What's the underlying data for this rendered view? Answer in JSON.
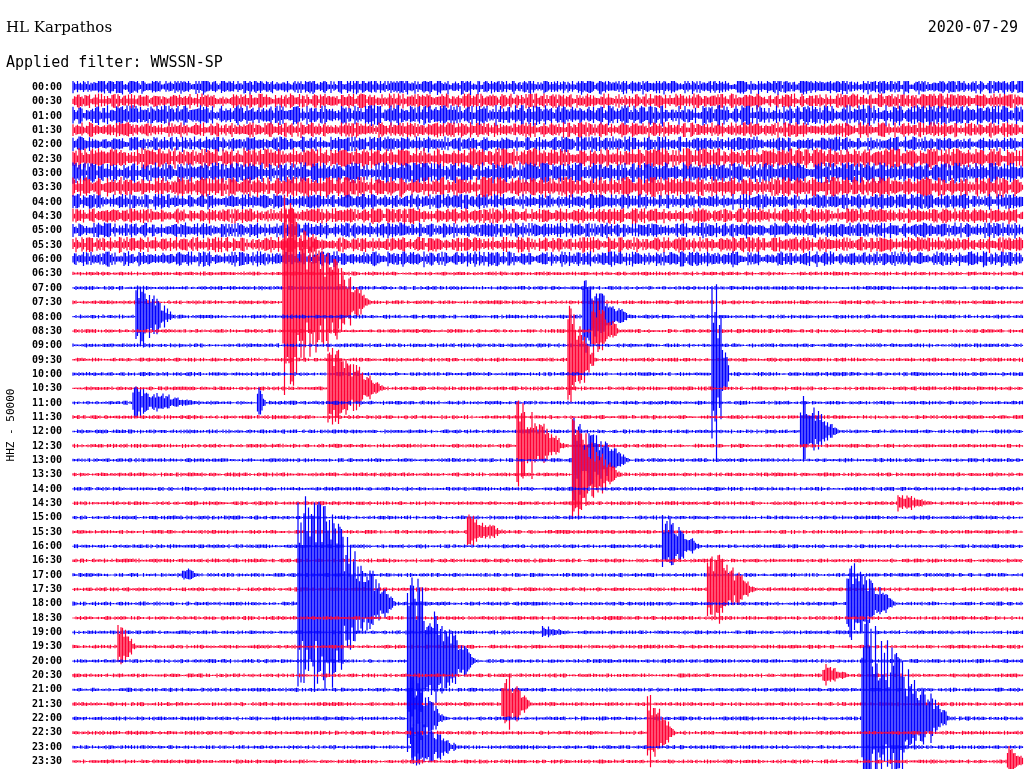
{
  "station": "HL Karpathos",
  "date": "2020-07-29",
  "filter": "Applied filter: WWSSN-SP",
  "channel_label": "HHZ - 50000",
  "traces": [
    {
      "time": "00:00",
      "color": "#0000ff"
    },
    {
      "time": "00:30",
      "color": "#ff0033"
    },
    {
      "time": "01:00",
      "color": "#0000ff"
    },
    {
      "time": "01:30",
      "color": "#ff0033"
    },
    {
      "time": "02:00",
      "color": "#0000ff"
    },
    {
      "time": "02:30",
      "color": "#ff0033"
    },
    {
      "time": "03:00",
      "color": "#0000ff"
    },
    {
      "time": "03:30",
      "color": "#ff0033"
    },
    {
      "time": "04:00",
      "color": "#0000ff"
    },
    {
      "time": "04:30",
      "color": "#ff0033"
    },
    {
      "time": "05:00",
      "color": "#0000ff"
    },
    {
      "time": "05:30",
      "color": "#ff0033"
    },
    {
      "time": "06:00",
      "color": "#0000ff"
    },
    {
      "time": "06:30",
      "color": "#ff0033"
    },
    {
      "time": "07:00",
      "color": "#0000ff"
    },
    {
      "time": "07:30",
      "color": "#ff0033"
    },
    {
      "time": "08:00",
      "color": "#0000ff"
    },
    {
      "time": "08:30",
      "color": "#ff0033"
    },
    {
      "time": "09:00",
      "color": "#0000ff"
    },
    {
      "time": "09:30",
      "color": "#ff0033"
    },
    {
      "time": "10:00",
      "color": "#0000ff"
    },
    {
      "time": "10:30",
      "color": "#ff0033"
    },
    {
      "time": "11:00",
      "color": "#0000ff"
    },
    {
      "time": "11:30",
      "color": "#ff0033"
    },
    {
      "time": "12:00",
      "color": "#0000ff"
    },
    {
      "time": "12:30",
      "color": "#ff0033"
    },
    {
      "time": "13:00",
      "color": "#0000ff"
    },
    {
      "time": "13:30",
      "color": "#ff0033"
    },
    {
      "time": "14:00",
      "color": "#0000ff"
    },
    {
      "time": "14:30",
      "color": "#ff0033"
    },
    {
      "time": "15:00",
      "color": "#0000ff"
    },
    {
      "time": "15:30",
      "color": "#ff0033"
    },
    {
      "time": "16:00",
      "color": "#0000ff"
    },
    {
      "time": "16:30",
      "color": "#ff0033"
    },
    {
      "time": "17:00",
      "color": "#0000ff"
    },
    {
      "time": "17:30",
      "color": "#ff0033"
    },
    {
      "time": "18:00",
      "color": "#0000ff"
    },
    {
      "time": "18:30",
      "color": "#ff0033"
    },
    {
      "time": "19:00",
      "color": "#0000ff"
    },
    {
      "time": "19:30",
      "color": "#ff0033"
    },
    {
      "time": "20:00",
      "color": "#0000ff"
    },
    {
      "time": "20:30",
      "color": "#ff0033"
    },
    {
      "time": "21:00",
      "color": "#0000ff"
    },
    {
      "time": "21:30",
      "color": "#ff0033"
    },
    {
      "time": "22:00",
      "color": "#0000ff"
    },
    {
      "time": "22:30",
      "color": "#ff0033"
    },
    {
      "time": "23:00",
      "color": "#0000ff"
    },
    {
      "time": "23:30",
      "color": "#ff0033"
    }
  ]
}
